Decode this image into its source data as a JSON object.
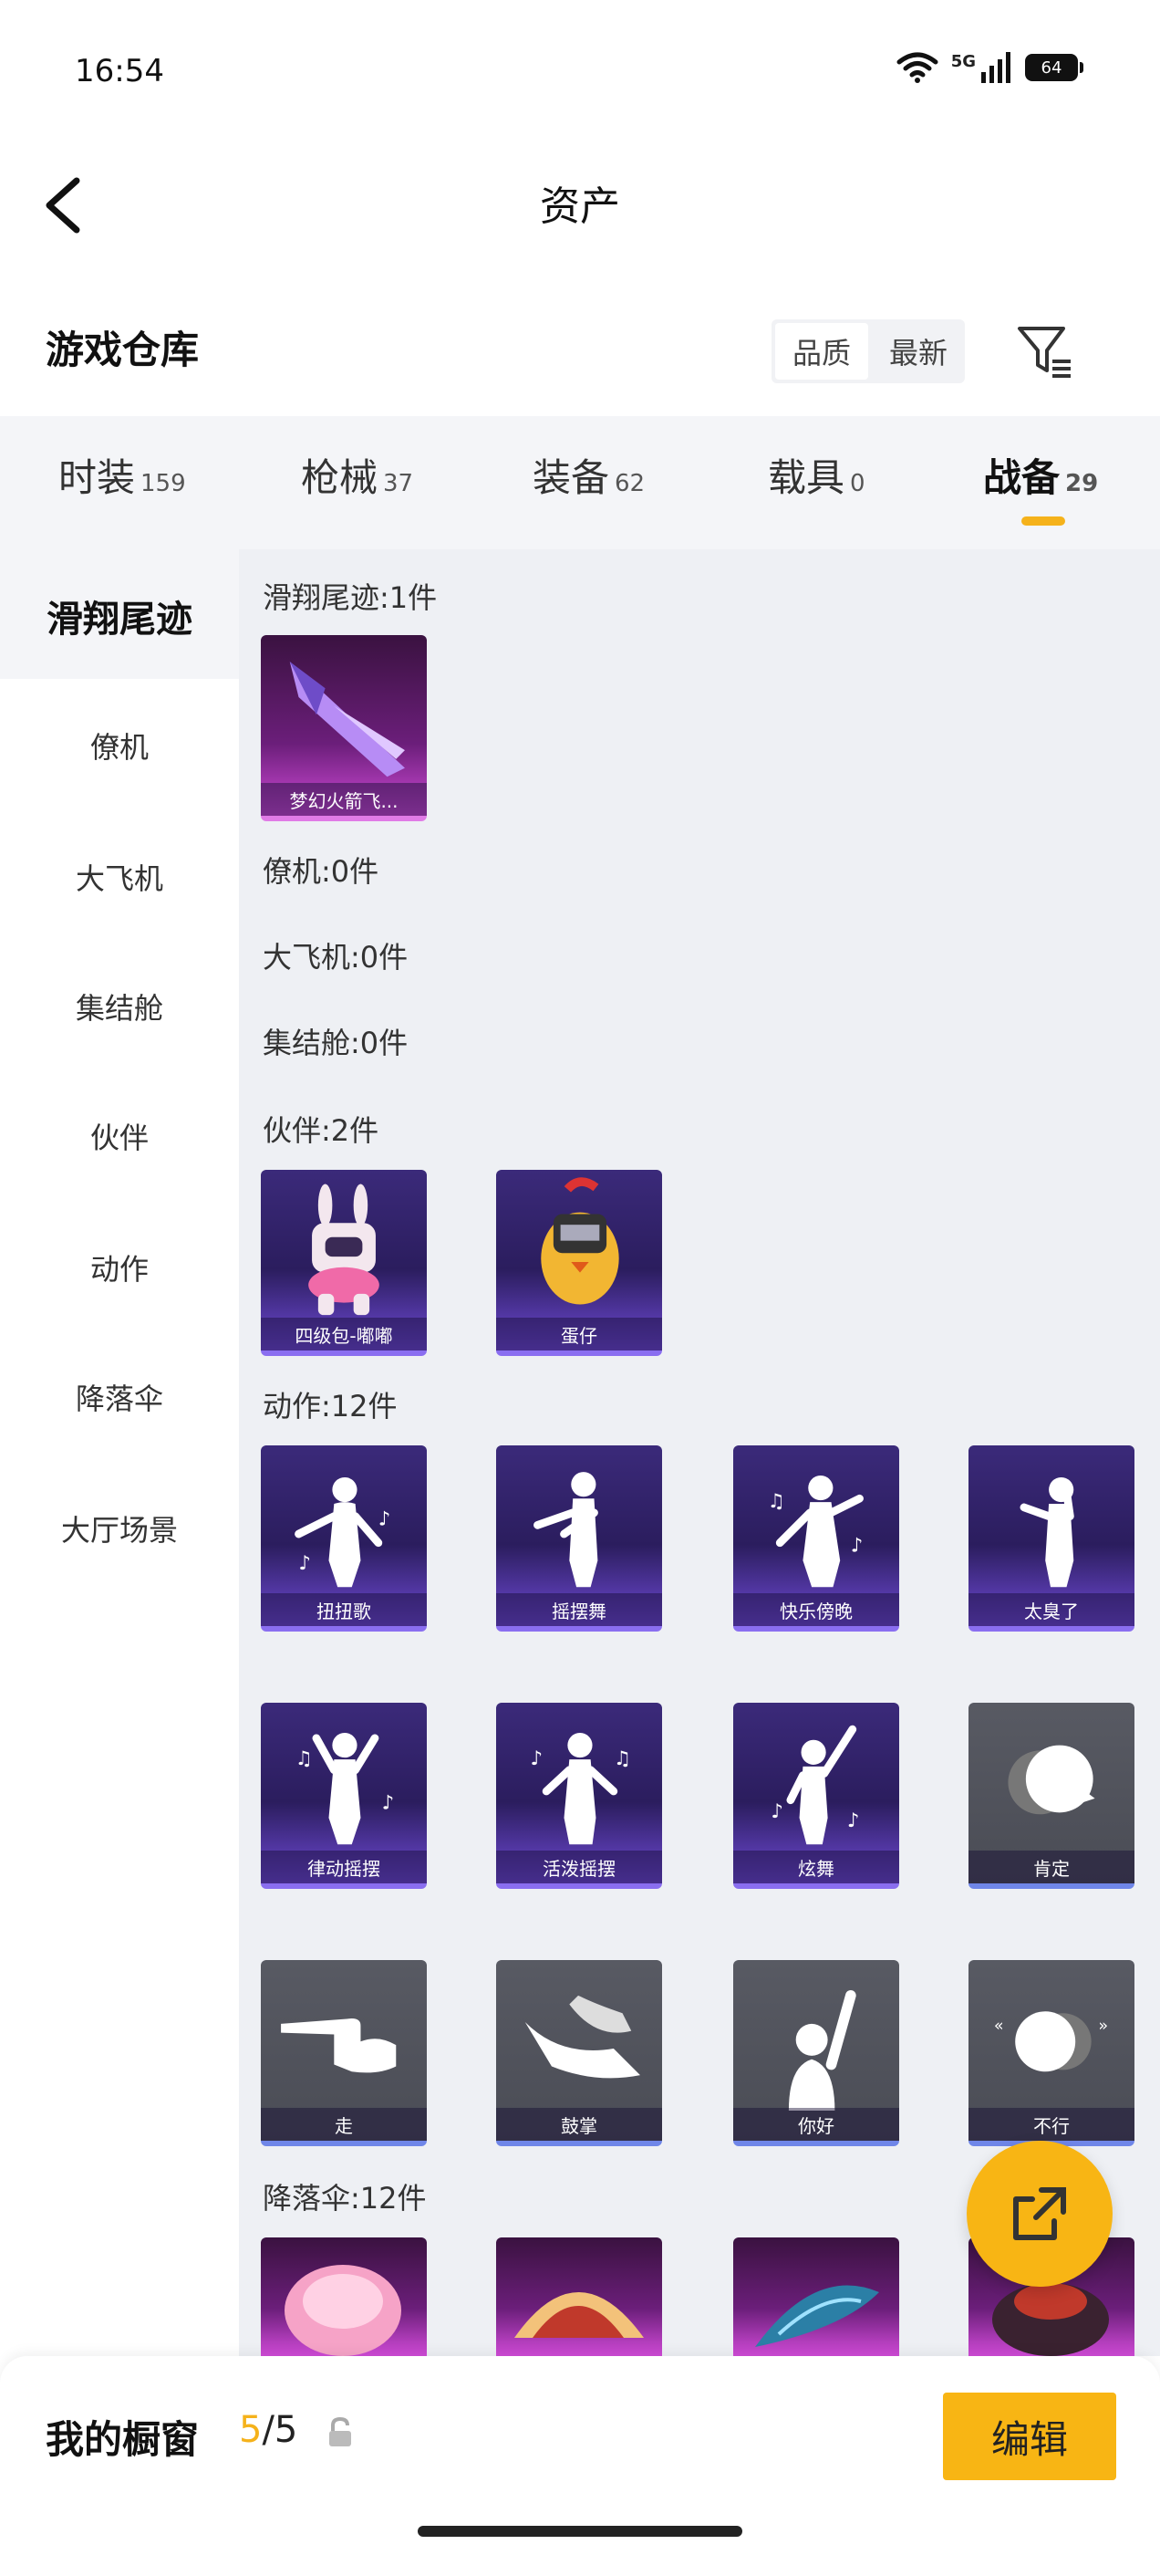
{
  "status": {
    "time": "16:54",
    "network": "5G",
    "battery": "64"
  },
  "header": {
    "title": "资产"
  },
  "warehouse": {
    "title": "游戏仓库",
    "sort_options": [
      "品质",
      "最新"
    ]
  },
  "tabs": [
    {
      "label": "时装",
      "count": "159"
    },
    {
      "label": "枪械",
      "count": "37"
    },
    {
      "label": "装备",
      "count": "62"
    },
    {
      "label": "载具",
      "count": "0"
    },
    {
      "label": "战备",
      "count": "29"
    }
  ],
  "sidebar": {
    "items": [
      "滑翔尾迹",
      "僚机",
      "大飞机",
      "集结舱",
      "伙伴",
      "动作",
      "降落伞",
      "大厅场景"
    ]
  },
  "sections": {
    "glide_trail": {
      "title": "滑翔尾迹:1件",
      "items": [
        "梦幻火箭飞..."
      ]
    },
    "wingman": {
      "title": "僚机:0件"
    },
    "plane": {
      "title": "大飞机:0件"
    },
    "pod": {
      "title": "集结舱:0件"
    },
    "partner": {
      "title": "伙伴:2件",
      "items": [
        "四级包-嘟嘟",
        "蛋仔"
      ]
    },
    "emote": {
      "title": "动作:12件",
      "items": [
        "扭扭歌",
        "摇摆舞",
        "快乐傍晚",
        "太臭了",
        "律动摇摆",
        "活泼摇摆",
        "炫舞",
        "肯定",
        "走",
        "鼓掌",
        "你好",
        "不行"
      ]
    },
    "parachute": {
      "title": "降落伞:12件"
    }
  },
  "bottom": {
    "showcase_label": "我的橱窗",
    "count_current": "5",
    "count_total": "/5",
    "edit_label": "编辑"
  },
  "colors": {
    "accent": "#f8b514",
    "purple_card": "#3b2a7a",
    "gray_card": "#4a4c55"
  }
}
